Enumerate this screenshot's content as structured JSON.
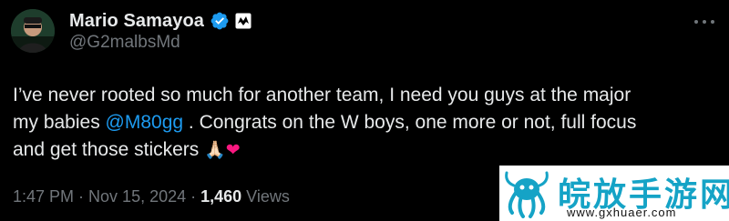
{
  "author": {
    "display_name": "Mario Samayoa",
    "handle": "@G2malbsMd",
    "verified": true,
    "affiliate_icon": "g2-esports-badge"
  },
  "tweet": {
    "line1": "I’ve never rooted so much for another team, I need you guys at the major",
    "line2_before": "my babies ",
    "mention": "@M80gg",
    "line2_after": " . Congrats on the W boys, one more or not, full focus",
    "line3": "and get those stickers ",
    "emoji_pray": "🙏🏻",
    "emoji_heart": "❤"
  },
  "meta": {
    "time": "1:47 PM",
    "sep1": " · ",
    "date": "Nov 15, 2024",
    "sep2": " · ",
    "views_count": "1,460",
    "views_label": " Views"
  },
  "watermark": {
    "text": "皖放手游网",
    "url": "www.gxhuaer.com"
  },
  "colors": {
    "background": "#000000",
    "text": "#e7e9ea",
    "muted": "#71767b",
    "link": "#1d9bf0",
    "heart": "#f91880"
  },
  "icons": [
    "avatar",
    "verified-badge-icon",
    "affiliate-badge-icon",
    "more-options-icon",
    "watermark-logo-icon"
  ]
}
